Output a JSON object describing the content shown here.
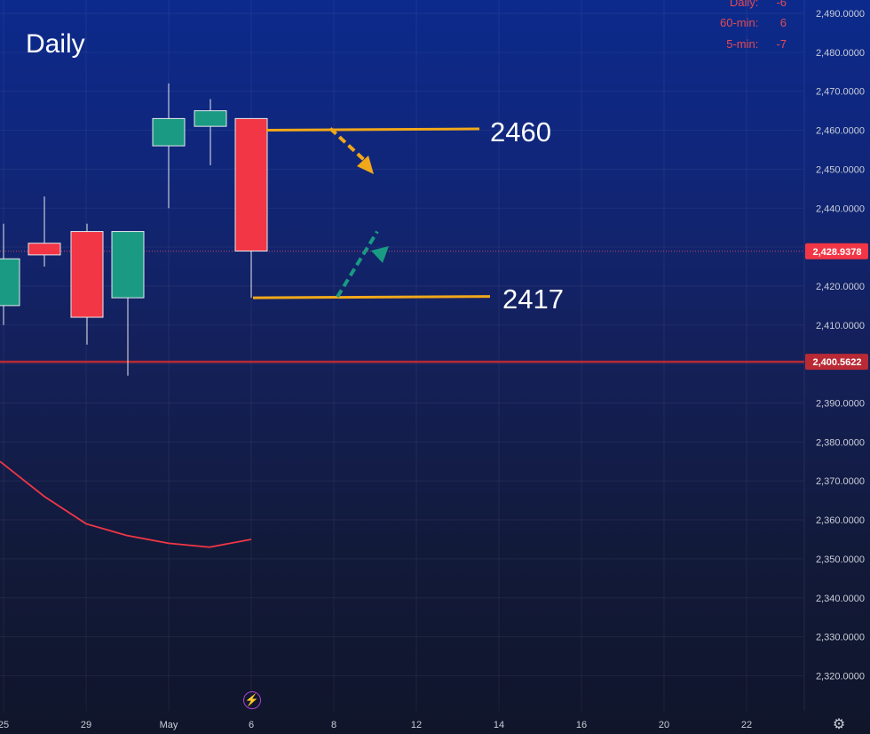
{
  "title": "Daily",
  "indicators": [
    {
      "label": "Daily:",
      "value": "-6"
    },
    {
      "label": "60-min:",
      "value": "6"
    },
    {
      "label": "5-min:",
      "value": "-7"
    }
  ],
  "annotations": {
    "upper_label": "2460",
    "lower_label": "2417"
  },
  "icons": {
    "lightning": "lightning-icon",
    "settings": "gear-icon"
  },
  "colors": {
    "up": "#1a9a82",
    "down": "#f23645",
    "level": "#f0a81a",
    "support": "#b92a35",
    "current_price": "#f23645"
  },
  "chart_data": {
    "type": "candlestick",
    "title": "Daily",
    "x_tick_labels": [
      "25",
      "29",
      "May",
      "6",
      "8",
      "12",
      "14",
      "16",
      "20",
      "22"
    ],
    "y_tick_labels": [
      "2,320.0000",
      "2,330.0000",
      "2,340.0000",
      "2,350.0000",
      "2,360.0000",
      "2,370.0000",
      "2,380.0000",
      "2,390.0000",
      "2,400.0000",
      "2,410.0000",
      "2,420.0000",
      "2,430.0000",
      "2,440.0000",
      "2,450.0000",
      "2,460.0000",
      "2,470.0000",
      "2,480.0000",
      "2,490.0000"
    ],
    "ylim": [
      2316,
      2494
    ],
    "candles": [
      {
        "date": "Apr 25",
        "open": 2415,
        "high": 2436,
        "low": 2410,
        "close": 2427
      },
      {
        "date": "Apr 26",
        "open": 2431,
        "high": 2443,
        "low": 2425,
        "close": 2428
      },
      {
        "date": "Apr 29",
        "open": 2434,
        "high": 2436,
        "low": 2405,
        "close": 2412
      },
      {
        "date": "Apr 30",
        "open": 2417,
        "high": 2434,
        "low": 2397,
        "close": 2434
      },
      {
        "date": "May 2",
        "open": 2456,
        "high": 2472,
        "low": 2440,
        "close": 2463
      },
      {
        "date": "May 3",
        "open": 2461,
        "high": 2468,
        "low": 2451,
        "close": 2465
      },
      {
        "date": "May 6",
        "open": 2463,
        "high": 2463,
        "low": 2417,
        "close": 2429
      }
    ],
    "moving_average": [
      2375,
      2366,
      2359,
      2356,
      2354,
      2353,
      2355
    ],
    "levels": {
      "resistance": 2460,
      "support_target": 2417,
      "horizontal_support": 2400.5622
    },
    "price_labels": {
      "current": "2,428.9378",
      "support": "2,400.5622"
    },
    "current_price": 2428.9378,
    "grid": true
  }
}
